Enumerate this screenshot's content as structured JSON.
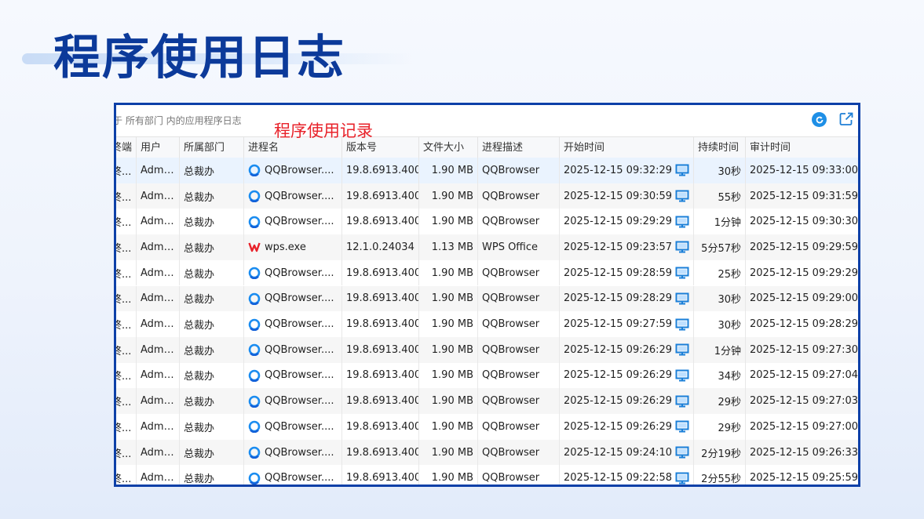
{
  "slide": {
    "title": "程序使用日志"
  },
  "window": {
    "caption": "于 所有部门 内的应用程序日志",
    "annotation": "程序使用记录",
    "refresh_icon": "refresh-icon",
    "export_icon": "export-icon"
  },
  "table": {
    "headers": [
      "终端",
      "用户",
      "所属部门",
      "进程名",
      "版本号",
      "文件大小",
      "进程描述",
      "开始时间",
      "持续时间",
      "审计时间"
    ],
    "rows": [
      {
        "terminal": "终...",
        "user": "Admi...",
        "dept": "总裁办",
        "process": "QQBrowser....",
        "icon": "qqbrowser",
        "version": "19.8.6913.400",
        "size": "1.90 MB",
        "desc": "QQBrowser",
        "start": "2025-12-15 09:32:29",
        "duration": "30秒",
        "audit": "2025-12-15 09:33:00"
      },
      {
        "terminal": "终...",
        "user": "Admi...",
        "dept": "总裁办",
        "process": "QQBrowser....",
        "icon": "qqbrowser",
        "version": "19.8.6913.400",
        "size": "1.90 MB",
        "desc": "QQBrowser",
        "start": "2025-12-15 09:30:59",
        "duration": "55秒",
        "audit": "2025-12-15 09:31:59"
      },
      {
        "terminal": "终...",
        "user": "Admi...",
        "dept": "总裁办",
        "process": "QQBrowser....",
        "icon": "qqbrowser",
        "version": "19.8.6913.400",
        "size": "1.90 MB",
        "desc": "QQBrowser",
        "start": "2025-12-15 09:29:29",
        "duration": "1分钟",
        "audit": "2025-12-15 09:30:30"
      },
      {
        "terminal": "终...",
        "user": "Admi...",
        "dept": "总裁办",
        "process": "wps.exe",
        "icon": "wps",
        "version": "12.1.0.24034",
        "size": "1.13 MB",
        "desc": "WPS Office",
        "start": "2025-12-15 09:23:57",
        "duration": "5分57秒",
        "audit": "2025-12-15 09:29:59"
      },
      {
        "terminal": "终...",
        "user": "Admi...",
        "dept": "总裁办",
        "process": "QQBrowser....",
        "icon": "qqbrowser",
        "version": "19.8.6913.400",
        "size": "1.90 MB",
        "desc": "QQBrowser",
        "start": "2025-12-15 09:28:59",
        "duration": "25秒",
        "audit": "2025-12-15 09:29:29"
      },
      {
        "terminal": "终...",
        "user": "Admi...",
        "dept": "总裁办",
        "process": "QQBrowser....",
        "icon": "qqbrowser",
        "version": "19.8.6913.400",
        "size": "1.90 MB",
        "desc": "QQBrowser",
        "start": "2025-12-15 09:28:29",
        "duration": "30秒",
        "audit": "2025-12-15 09:29:00"
      },
      {
        "terminal": "终...",
        "user": "Admi...",
        "dept": "总裁办",
        "process": "QQBrowser....",
        "icon": "qqbrowser",
        "version": "19.8.6913.400",
        "size": "1.90 MB",
        "desc": "QQBrowser",
        "start": "2025-12-15 09:27:59",
        "duration": "30秒",
        "audit": "2025-12-15 09:28:29"
      },
      {
        "terminal": "终...",
        "user": "Admi...",
        "dept": "总裁办",
        "process": "QQBrowser....",
        "icon": "qqbrowser",
        "version": "19.8.6913.400",
        "size": "1.90 MB",
        "desc": "QQBrowser",
        "start": "2025-12-15 09:26:29",
        "duration": "1分钟",
        "audit": "2025-12-15 09:27:30"
      },
      {
        "terminal": "终...",
        "user": "Admi...",
        "dept": "总裁办",
        "process": "QQBrowser....",
        "icon": "qqbrowser",
        "version": "19.8.6913.400",
        "size": "1.90 MB",
        "desc": "QQBrowser",
        "start": "2025-12-15 09:26:29",
        "duration": "34秒",
        "audit": "2025-12-15 09:27:04"
      },
      {
        "terminal": "终...",
        "user": "Admi...",
        "dept": "总裁办",
        "process": "QQBrowser....",
        "icon": "qqbrowser",
        "version": "19.8.6913.400",
        "size": "1.90 MB",
        "desc": "QQBrowser",
        "start": "2025-12-15 09:26:29",
        "duration": "29秒",
        "audit": "2025-12-15 09:27:03"
      },
      {
        "terminal": "终...",
        "user": "Admi...",
        "dept": "总裁办",
        "process": "QQBrowser....",
        "icon": "qqbrowser",
        "version": "19.8.6913.400",
        "size": "1.90 MB",
        "desc": "QQBrowser",
        "start": "2025-12-15 09:26:29",
        "duration": "29秒",
        "audit": "2025-12-15 09:27:00"
      },
      {
        "terminal": "终...",
        "user": "Admi...",
        "dept": "总裁办",
        "process": "QQBrowser....",
        "icon": "qqbrowser",
        "version": "19.8.6913.400",
        "size": "1.90 MB",
        "desc": "QQBrowser",
        "start": "2025-12-15 09:24:10",
        "duration": "2分19秒",
        "audit": "2025-12-15 09:26:33"
      },
      {
        "terminal": "终...",
        "user": "Admi...",
        "dept": "总裁办",
        "process": "QQBrowser....",
        "icon": "qqbrowser",
        "version": "19.8.6913.400",
        "size": "1.90 MB",
        "desc": "QQBrowser",
        "start": "2025-12-15 09:22:58",
        "duration": "2分55秒",
        "audit": "2025-12-15 09:25:59"
      }
    ]
  }
}
